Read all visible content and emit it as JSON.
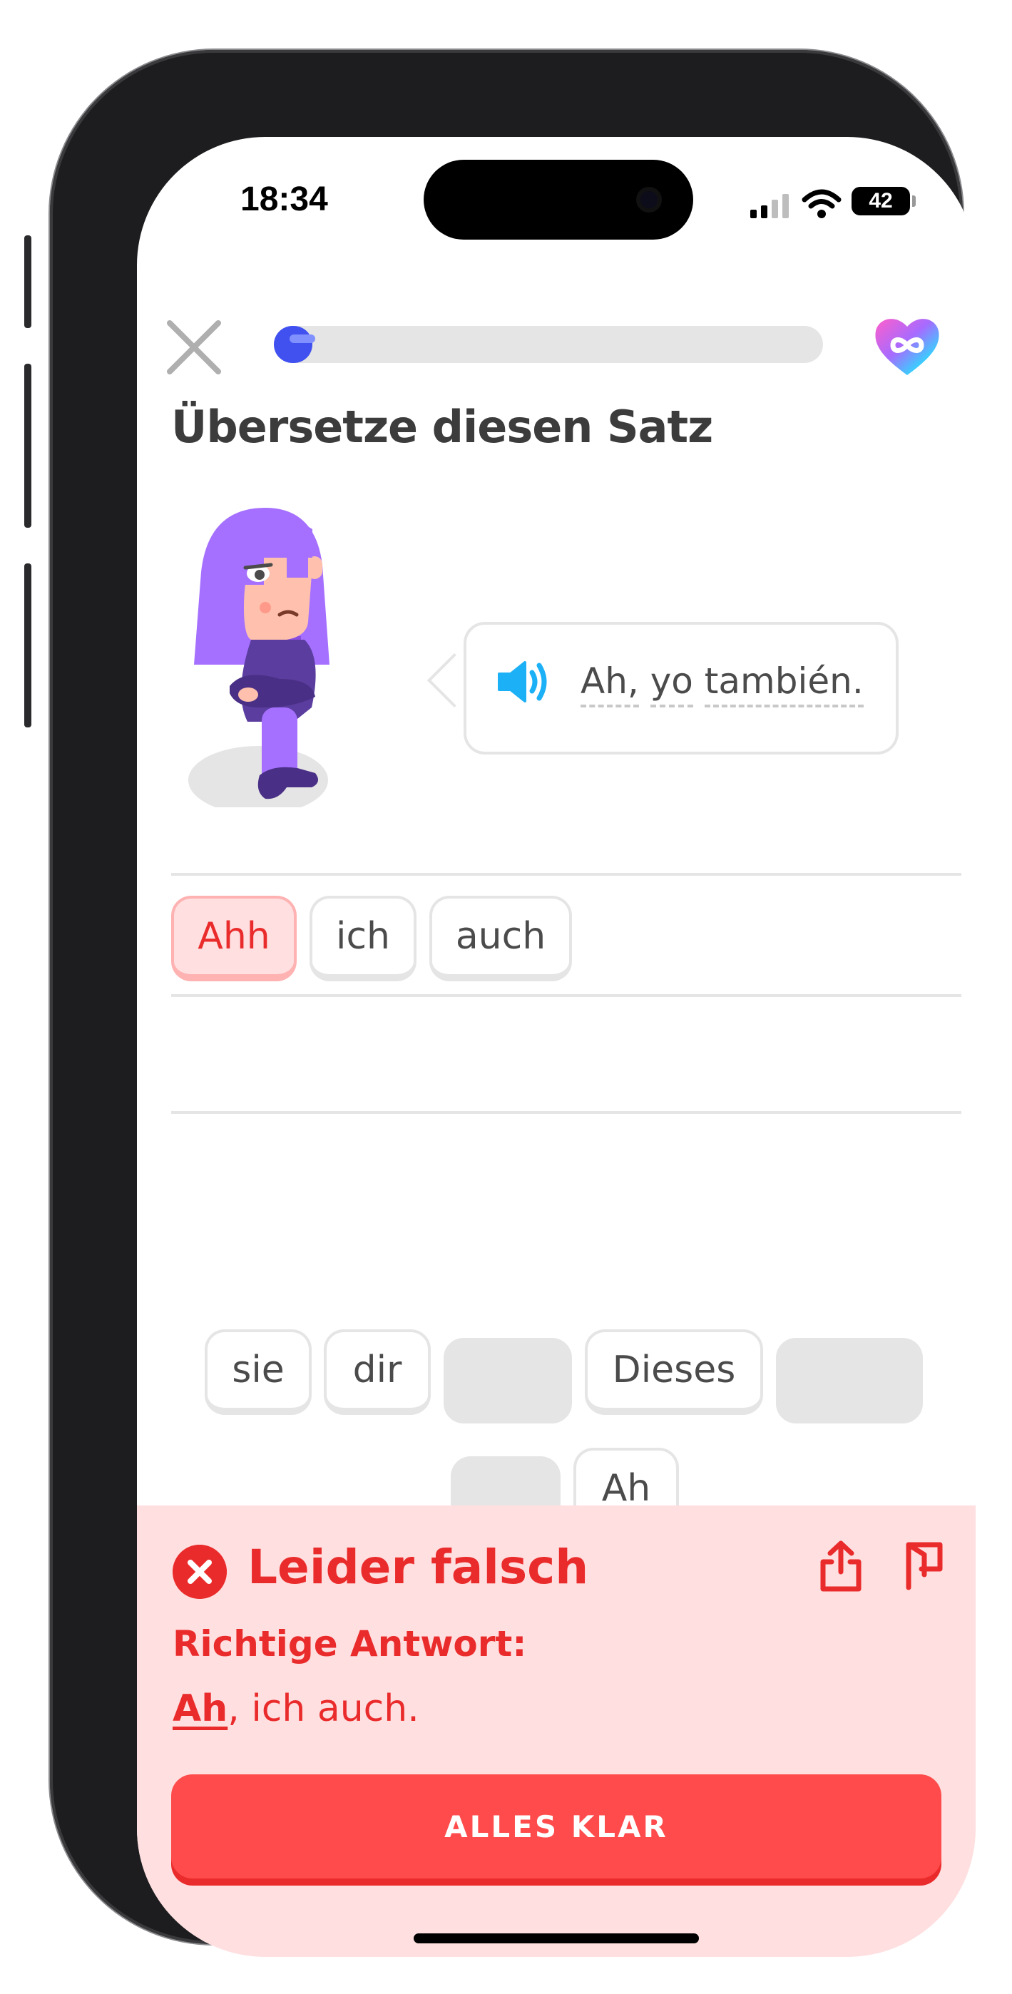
{
  "status_bar": {
    "time": "18:34",
    "battery": "42"
  },
  "header": {
    "close_icon": "close-icon",
    "progress_fraction": 0.07,
    "hearts_icon": "infinity-heart-icon"
  },
  "exercise": {
    "title": "Übersetze diesen Satz",
    "prompt_words": [
      "Ah,",
      "yo",
      "también."
    ],
    "speaker_icon": "speaker-icon",
    "answer_tiles": [
      "Ahh",
      "ich",
      "auch"
    ],
    "word_bank": [
      "sie",
      "dir",
      "Dieses",
      "Ah"
    ]
  },
  "feedback": {
    "title": "Leider falsch",
    "answer_label": "Richtige Antwort:",
    "answer_highlight": "Ah",
    "answer_rest": ", ich auch.",
    "button_label": "ALLES KLAR",
    "share_icon": "share-icon",
    "flag_icon": "flag-icon"
  },
  "colors": {
    "accent_blue": "#4051f0",
    "error_red": "#ea2b2b",
    "error_bg": "#ffdfe0",
    "button_red": "#ff4b4b",
    "character_purple": "#a570ff"
  }
}
